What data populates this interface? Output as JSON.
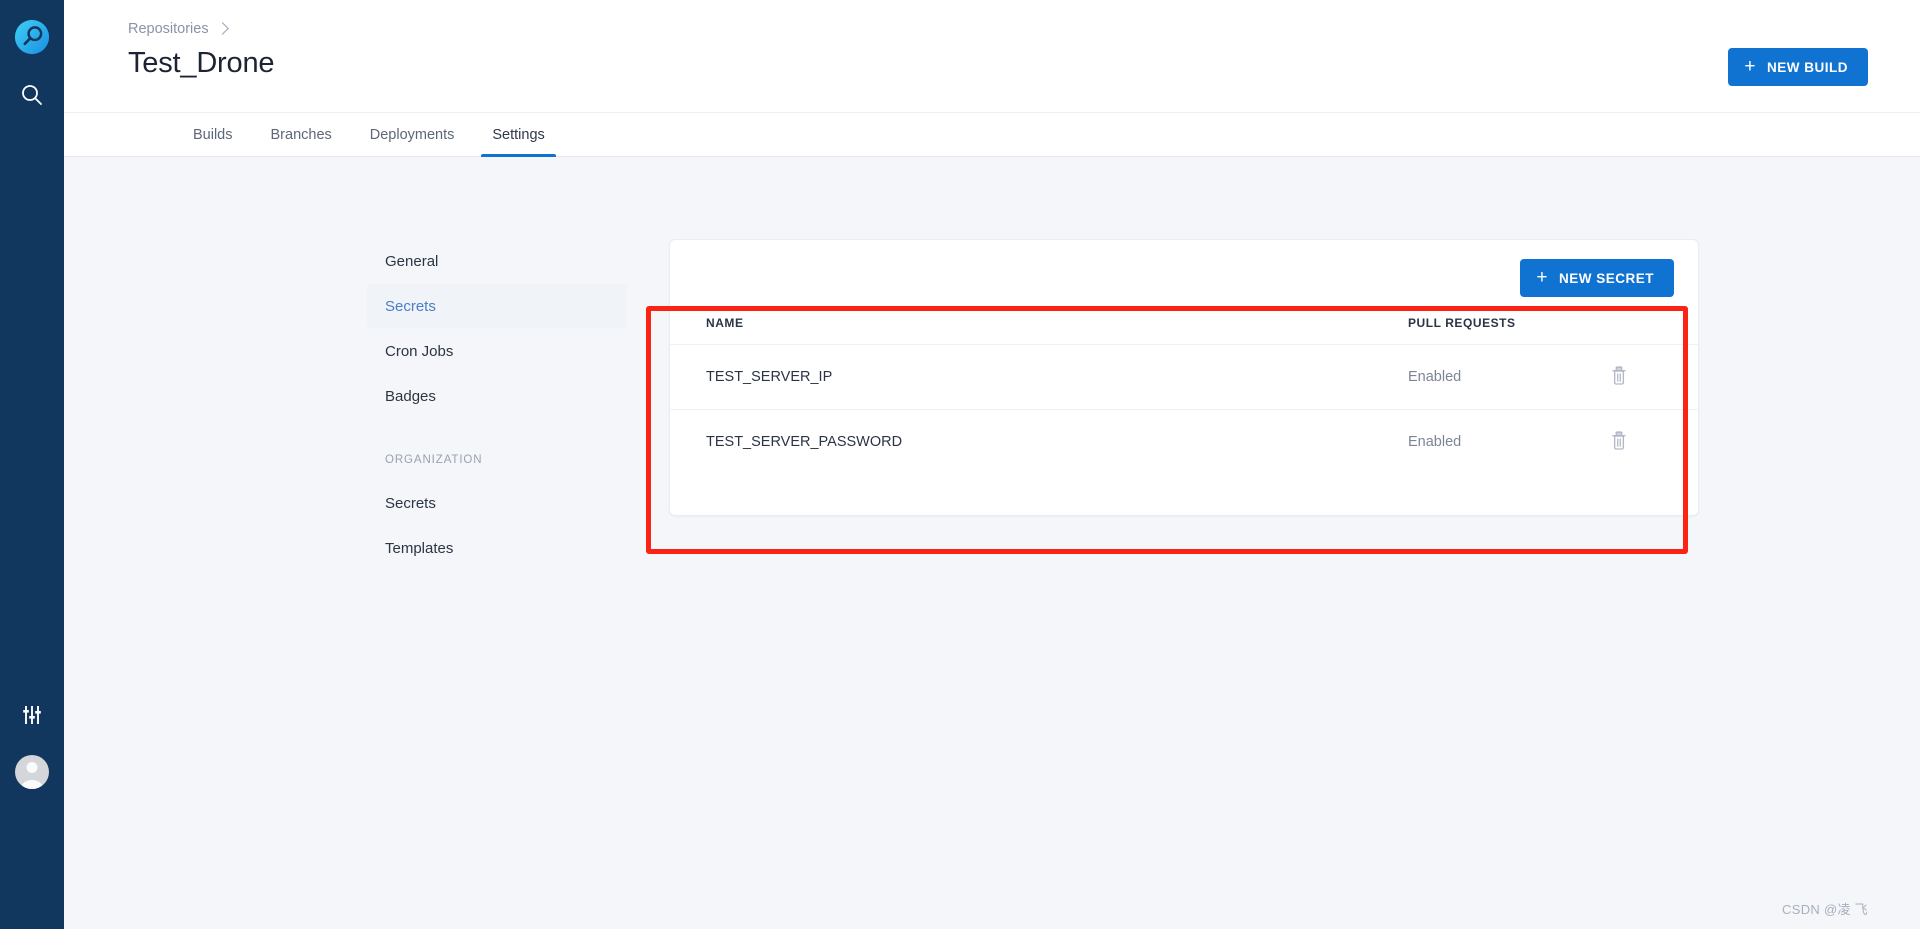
{
  "rail": {
    "logo_icon": "drone-logo-icon",
    "search_icon": "search-icon",
    "sliders_icon": "sliders-settings-icon",
    "avatar_icon": "user-avatar",
    "background_color": "#11375f"
  },
  "header": {
    "breadcrumb": {
      "parent": "Repositories",
      "separator_icon": "chevron-right-icon"
    },
    "title": "Test_Drone",
    "new_build_button": {
      "label": "NEW BUILD",
      "icon": "plus-icon",
      "color": "#1072d1"
    }
  },
  "tabs": [
    {
      "label": "Builds",
      "active": false
    },
    {
      "label": "Branches",
      "active": false
    },
    {
      "label": "Deployments",
      "active": false
    },
    {
      "label": "Settings",
      "active": true
    }
  ],
  "settings_nav": {
    "items": [
      {
        "label": "General",
        "active": false
      },
      {
        "label": "Secrets",
        "active": true
      },
      {
        "label": "Cron Jobs",
        "active": false
      },
      {
        "label": "Badges",
        "active": false
      }
    ],
    "group_label": "ORGANIZATION",
    "group_items": [
      {
        "label": "Secrets",
        "active": false
      },
      {
        "label": "Templates",
        "active": false
      }
    ]
  },
  "secrets_panel": {
    "new_secret_button": {
      "label": "NEW SECRET",
      "icon": "plus-icon",
      "color": "#1072d1"
    },
    "table": {
      "columns": [
        "NAME",
        "PULL REQUESTS",
        ""
      ],
      "rows": [
        {
          "name": "TEST_SERVER_IP",
          "pull_requests": "Enabled",
          "delete_icon": "trash-icon"
        },
        {
          "name": "TEST_SERVER_PASSWORD",
          "pull_requests": "Enabled",
          "delete_icon": "trash-icon"
        }
      ]
    }
  },
  "annotation": {
    "color": "#fb2414",
    "shape": "rectangle"
  },
  "watermark": {
    "text": "CSDN @凌 飞"
  }
}
